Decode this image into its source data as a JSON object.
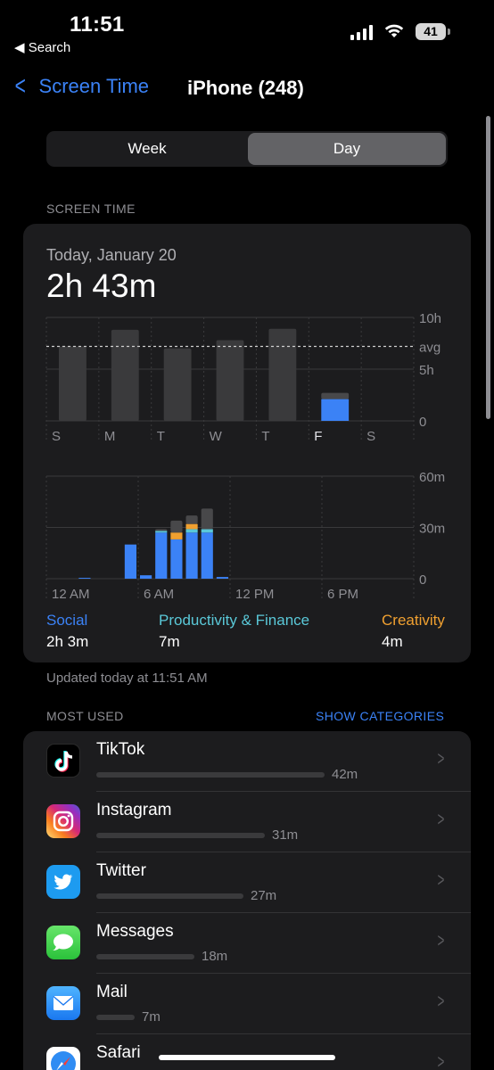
{
  "status": {
    "time": "11:51",
    "back_app": "Search",
    "battery": "41"
  },
  "nav": {
    "back_label": "Screen Time",
    "title": "iPhone (248)"
  },
  "segment": {
    "options": [
      "Week",
      "Day"
    ],
    "selected": "Day"
  },
  "section_label": "SCREEN TIME",
  "summary": {
    "date": "Today, January 20",
    "total": "2h 43m"
  },
  "weekly_chart": {
    "type": "bar",
    "categories": [
      "S",
      "M",
      "T",
      "W",
      "T",
      "F",
      "S"
    ],
    "values_hours": [
      7.2,
      8.8,
      7.0,
      7.8,
      8.9,
      2.7,
      0
    ],
    "highlight_index": 5,
    "highlight_social_hours": 2.1,
    "avg_hours": 7.2,
    "y_ticks": [
      "10h",
      "avg",
      "5h",
      "0"
    ],
    "ylim": [
      0,
      10
    ]
  },
  "hourly_chart": {
    "type": "bar",
    "x_ticks": [
      "12 AM",
      "6 AM",
      "12 PM",
      "6 PM"
    ],
    "y_ticks": [
      "60m",
      "30m",
      "0"
    ],
    "ylim": [
      0,
      60
    ],
    "hours": [
      0,
      1,
      2,
      3,
      4,
      5,
      6,
      7,
      8,
      9,
      10,
      11
    ],
    "social": [
      0,
      0,
      0.5,
      0,
      0,
      20,
      2,
      27,
      23,
      27,
      27,
      1
    ],
    "productivity": [
      0,
      0,
      0,
      0,
      0,
      0,
      0,
      1,
      0,
      2,
      2,
      0
    ],
    "creativity": [
      0,
      0,
      0,
      0,
      0,
      0,
      0,
      0,
      4,
      3,
      0,
      0
    ],
    "other": [
      0,
      0,
      0,
      0,
      0,
      0,
      0,
      1,
      7,
      5,
      12,
      0
    ]
  },
  "categories": [
    {
      "name": "Social",
      "value": "2h 3m",
      "color": "#3b82f6"
    },
    {
      "name": "Productivity & Finance",
      "value": "7m",
      "color": "#5ac8d8"
    },
    {
      "name": "Creativity",
      "value": "4m",
      "color": "#f0a030"
    }
  ],
  "updated": "Updated today at 11:51 AM",
  "most_used": {
    "label": "MOST USED",
    "toggle": "SHOW CATEGORIES",
    "apps": [
      {
        "name": "TikTok",
        "duration": "42m",
        "minutes": 42,
        "icon": "tiktok-icon"
      },
      {
        "name": "Instagram",
        "duration": "31m",
        "minutes": 31,
        "icon": "instagram-icon"
      },
      {
        "name": "Twitter",
        "duration": "27m",
        "minutes": 27,
        "icon": "twitter-icon"
      },
      {
        "name": "Messages",
        "duration": "18m",
        "minutes": 18,
        "icon": "messages-icon"
      },
      {
        "name": "Mail",
        "duration": "7m",
        "minutes": 7,
        "icon": "mail-icon"
      },
      {
        "name": "Safari",
        "duration": "",
        "minutes": 0,
        "icon": "safari-icon"
      }
    ]
  }
}
